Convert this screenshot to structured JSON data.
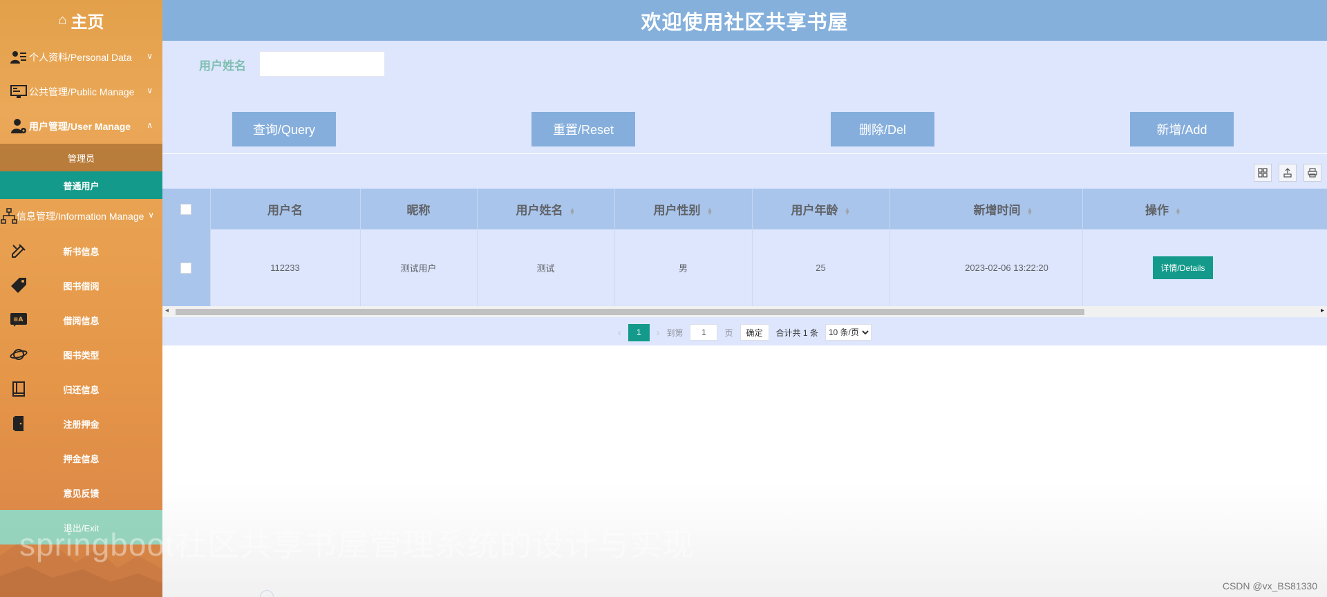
{
  "header": {
    "title": "欢迎使用社区共享书屋"
  },
  "sidebar": {
    "home": {
      "icon": "home-icon",
      "label": "主页"
    },
    "groups": [
      {
        "label": "个人资料/Personal Data",
        "icon": "user-card-icon",
        "expanded": false
      },
      {
        "label": "公共管理/Public Manage",
        "icon": "monitor-icon",
        "expanded": false
      },
      {
        "label": "用户管理/User Manage",
        "icon": "user-gear-icon",
        "expanded": true,
        "children": [
          "管理员",
          "普通用户"
        ],
        "active_child": "普通用户"
      },
      {
        "label": "信息管理/Information Manage",
        "icon": "sitemap-icon",
        "expanded": false
      }
    ],
    "items": [
      {
        "label": "新书信息",
        "icon": "pencil-ruler-icon"
      },
      {
        "label": "图书借阅",
        "icon": "tag-icon"
      },
      {
        "label": "借阅信息",
        "icon": "translate-icon"
      },
      {
        "label": "图书类型",
        "icon": "planet-icon"
      },
      {
        "label": "归还信息",
        "icon": "book-icon"
      },
      {
        "label": "注册押金",
        "icon": "door-icon"
      },
      {
        "label": "押金信息",
        "icon": ""
      },
      {
        "label": "意见反馈",
        "icon": ""
      }
    ],
    "exit_label": "退出/Exit",
    "watermark": "springboot社区共享书屋管理系统的设计与实现"
  },
  "search": {
    "label": "用户姓名",
    "value": "",
    "buttons": {
      "query": "查询/Query",
      "reset": "重置/Reset",
      "del": "删除/Del",
      "add": "新增/Add"
    }
  },
  "toolbar": {
    "icons": [
      "columns-icon",
      "export-icon",
      "print-icon"
    ]
  },
  "table": {
    "columns": [
      {
        "label": "用户名",
        "sortable": false
      },
      {
        "label": "昵称",
        "sortable": false
      },
      {
        "label": "用户姓名",
        "sortable": true
      },
      {
        "label": "用户性别",
        "sortable": true
      },
      {
        "label": "用户年龄",
        "sortable": true
      },
      {
        "label": "新增时间",
        "sortable": true
      },
      {
        "label": "操作",
        "sortable": true
      }
    ],
    "rows": [
      {
        "username": "112233",
        "nickname": "测试用户",
        "name": "测试",
        "gender": "男",
        "age": "25",
        "created": "2023-02-06 13:22:20",
        "action": "详情/Details"
      }
    ]
  },
  "pagination": {
    "current_page": "1",
    "goto_label": "到第",
    "goto_value": "1",
    "page_suffix": "页",
    "confirm": "确定",
    "total": "合计共 1 条",
    "page_size": "10 条/页",
    "page_size_options": [
      "10 条/页"
    ]
  },
  "footer": {
    "credit": "CSDN @vx_BS81330"
  },
  "colors": {
    "header": "#85b0dc",
    "panel": "#dde6fd",
    "button": "#85aedc",
    "accent": "#139a8a",
    "sidebar": "#e8a050"
  }
}
